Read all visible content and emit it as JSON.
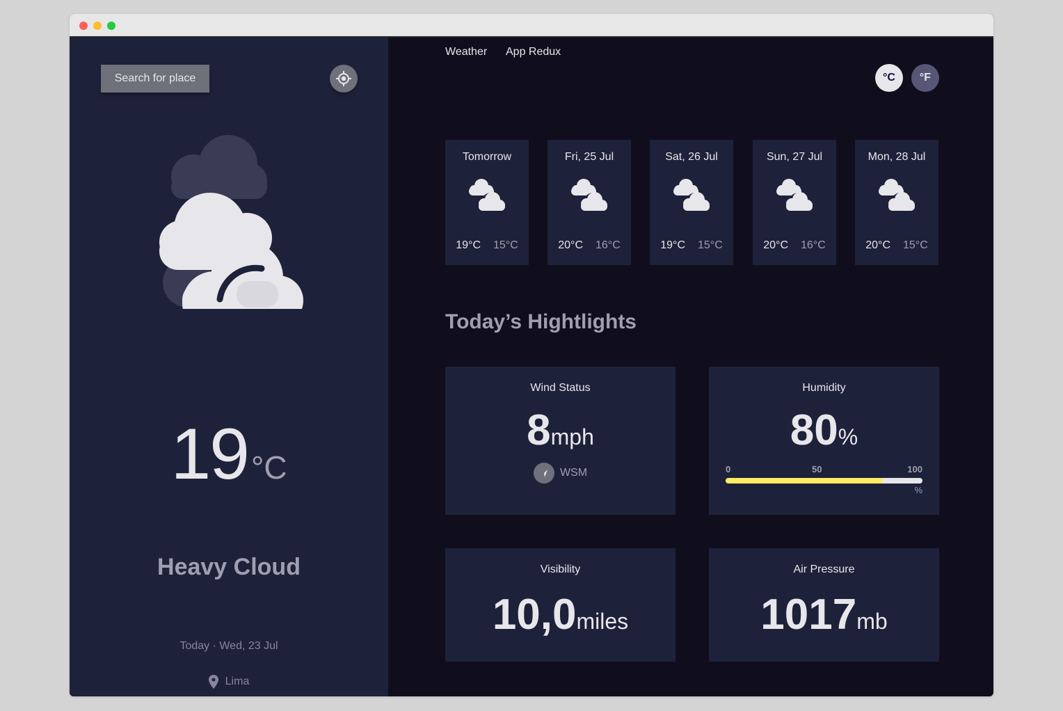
{
  "sidebar": {
    "search_label": "Search for place",
    "temperature": "19",
    "temperature_unit": "°C",
    "condition": "Heavy Cloud",
    "date": "Today · Wed, 23 Jul",
    "location": "Lima"
  },
  "nav": {
    "link1": "Weather",
    "link2": "App Redux"
  },
  "units": {
    "celsius": "°C",
    "fahrenheit": "°F",
    "selected": "°C"
  },
  "forecast": [
    {
      "day": "Tomorrow",
      "max": "19°C",
      "min": "15°C",
      "icon": "heavy-cloud-icon"
    },
    {
      "day": "Fri, 25 Jul",
      "max": "20°C",
      "min": "16°C",
      "icon": "heavy-cloud-icon"
    },
    {
      "day": "Sat, 26 Jul",
      "max": "19°C",
      "min": "15°C",
      "icon": "heavy-cloud-icon"
    },
    {
      "day": "Sun, 27 Jul",
      "max": "20°C",
      "min": "16°C",
      "icon": "heavy-cloud-icon"
    },
    {
      "day": "Mon, 28 Jul",
      "max": "20°C",
      "min": "15°C",
      "icon": "heavy-cloud-icon"
    }
  ],
  "highlights": {
    "title": "Today’s Hightlights",
    "wind": {
      "label": "Wind Status",
      "value": "8",
      "unit": "mph",
      "direction": "WSM"
    },
    "humidity": {
      "label": "Humidity",
      "value": "80",
      "unit": "%",
      "scale_0": "0",
      "scale_50": "50",
      "scale_100": "100",
      "scale_unit": "%",
      "fraction": 0.8
    },
    "visibility": {
      "label": "Visibility",
      "value": "10,0",
      "unit": "miles"
    },
    "pressure": {
      "label": "Air Pressure",
      "value": "1017",
      "unit": "mb"
    }
  },
  "colors": {
    "sidebar_bg": "#1e213a",
    "main_bg": "#100e1d",
    "humidity_fill": "#ffec65"
  }
}
